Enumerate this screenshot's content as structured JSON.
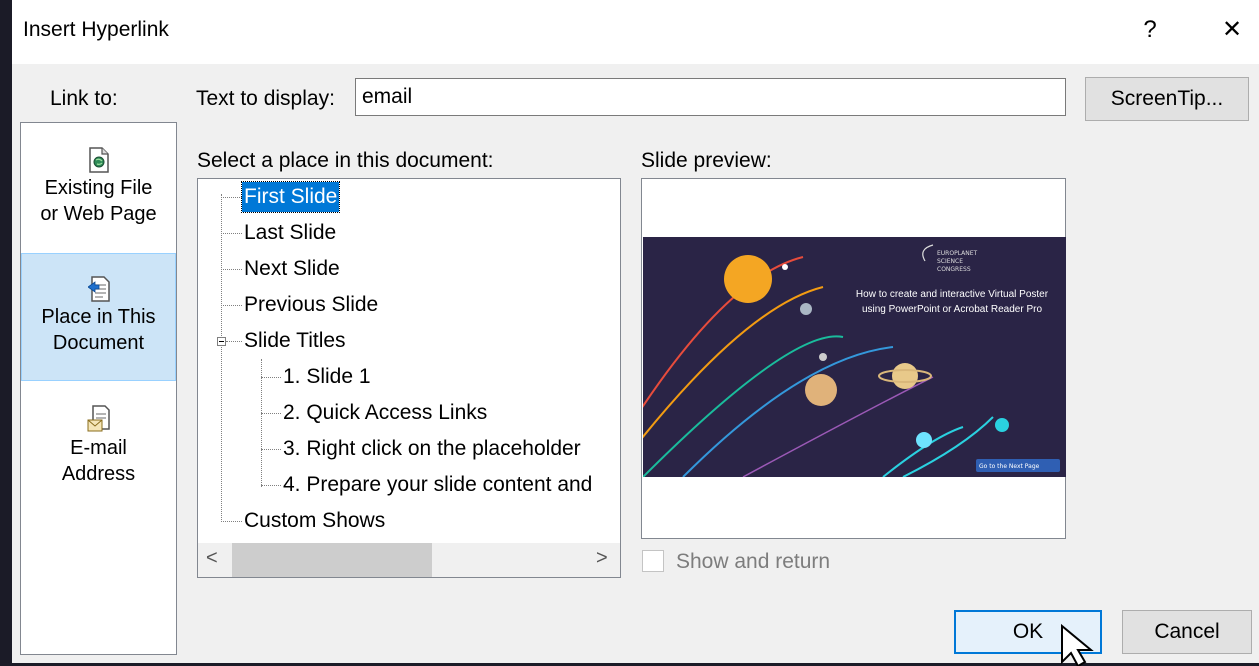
{
  "dialog": {
    "title": "Insert Hyperlink",
    "help_glyph": "?",
    "close_glyph": "✕",
    "link_to_label": "Link to:",
    "text_to_display_label": "Text to display:",
    "text_to_display_value": "email",
    "screentip_button": "ScreenTip...",
    "select_place_label": "Select a place in this document:",
    "slide_preview_label": "Slide preview:",
    "show_and_return_label": "Show and return",
    "show_and_return_checked": false,
    "ok_button": "OK",
    "cancel_button": "Cancel"
  },
  "link_to": {
    "items": [
      {
        "line1": "Existing File",
        "line2": "or Web Page",
        "icon": "web-page-icon",
        "selected": false
      },
      {
        "line1": "Place in This",
        "line2": "Document",
        "icon": "document-place-icon",
        "selected": true
      },
      {
        "line1": "E-mail",
        "line2": "Address",
        "icon": "email-icon",
        "selected": false
      }
    ]
  },
  "tree": {
    "items": [
      {
        "label": "First Slide",
        "selected": true
      },
      {
        "label": "Last Slide"
      },
      {
        "label": "Next Slide"
      },
      {
        "label": "Previous Slide"
      },
      {
        "label": "Slide Titles",
        "expanded": true
      },
      {
        "label": "1. Slide 1"
      },
      {
        "label": "2. Quick Access Links"
      },
      {
        "label": "3. Right click on the placeholder"
      },
      {
        "label": "4. Prepare your slide content and"
      },
      {
        "label": "Custom Shows"
      }
    ],
    "scroll_left_glyph": "<",
    "scroll_right_glyph": ">"
  },
  "preview": {
    "slide_title": "How to create and interactive Virtual Poster using PowerPoint or Acrobat Reader Pro",
    "logo_text_1": "EUROPLANET",
    "logo_text_2": "SCIENCE",
    "logo_text_3": "CONGRESS",
    "nav_button_text": "Go to the Next Page",
    "colors": {
      "background": "#2a2446",
      "sun": "#f4a623",
      "accent": "#2ad1e0"
    }
  }
}
